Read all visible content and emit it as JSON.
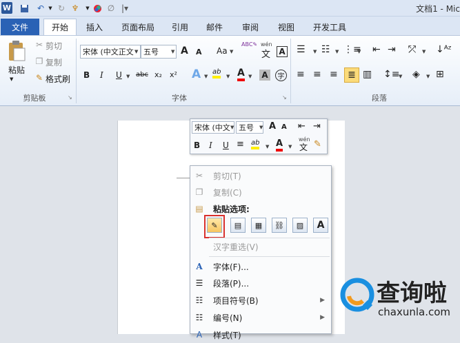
{
  "window": {
    "title": "文档1 - Mic"
  },
  "quick_access": {
    "logo": "W",
    "icons": [
      "save-icon",
      "undo-icon",
      "redo-icon",
      "format-painter-icon",
      "color-circle-icon",
      "draw-icon",
      "customize-icon"
    ]
  },
  "tabs": {
    "file": "文件",
    "home": "开始",
    "insert": "插入",
    "layout": "页面布局",
    "references": "引用",
    "mailings": "邮件",
    "review": "审阅",
    "view": "视图",
    "developer": "开发工具"
  },
  "ribbon": {
    "clipboard": {
      "paste": "粘贴",
      "cut": "剪切",
      "copy": "复制",
      "format_painter": "格式刷",
      "label": "剪贴板"
    },
    "font": {
      "font_name": "宋体 (中文正文",
      "font_size": "五号",
      "label": "字体",
      "grow": "A",
      "shrink": "A",
      "case": "Aa",
      "bold": "B",
      "italic": "I",
      "underline": "U",
      "strike": "abc",
      "sub": "x₂",
      "sup": "x²",
      "color_a": "A",
      "highlight": "ab",
      "char_border": "A",
      "phonetic": "字",
      "wen": "wén",
      "wen_char": "文"
    },
    "paragraph": {
      "label": "段落"
    }
  },
  "mini_toolbar": {
    "font_name": "宋体 (中文",
    "font_size": "五号",
    "bold": "B",
    "italic": "I",
    "underline": "U",
    "color": "A",
    "highlight": "ab"
  },
  "context_menu": {
    "cut": "剪切(T)",
    "copy": "复制(C)",
    "paste_options": "粘贴选项:",
    "reselect": "汉字重选(V)",
    "font": "字体(F)...",
    "paragraph": "段落(P)...",
    "bullets": "项目符号(B)",
    "numbering": "编号(N)",
    "styles": "样式(T)",
    "paste_icon_a": "A"
  },
  "watermark": {
    "name": "查询啦",
    "url": "chaxunla.com"
  },
  "colors": {
    "accent": "#2a62b5",
    "highlight_box": "#d9302c",
    "watermark_blue": "#1a8fe0"
  }
}
